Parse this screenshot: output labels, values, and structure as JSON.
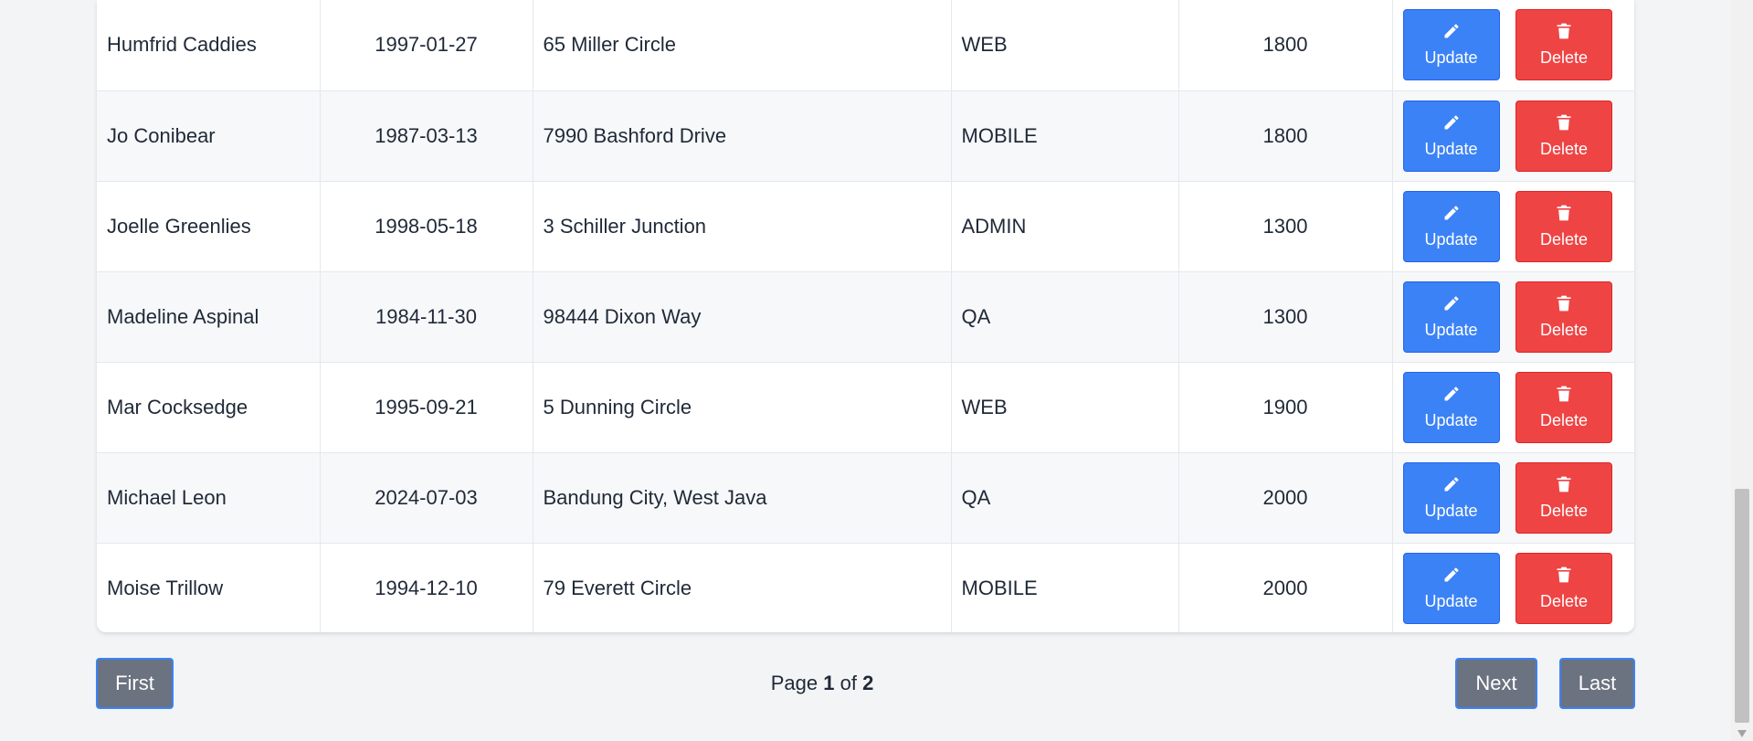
{
  "table": {
    "rows": [
      {
        "name": "Humfrid Caddies",
        "dob": "1997-01-27",
        "address": "65 Miller Circle",
        "role": "WEB",
        "salary": "1800"
      },
      {
        "name": "Jo Conibear",
        "dob": "1987-03-13",
        "address": "7990 Bashford Drive",
        "role": "MOBILE",
        "salary": "1800"
      },
      {
        "name": "Joelle Greenlies",
        "dob": "1998-05-18",
        "address": "3 Schiller Junction",
        "role": "ADMIN",
        "salary": "1300"
      },
      {
        "name": "Madeline Aspinal",
        "dob": "1984-11-30",
        "address": "98444 Dixon Way",
        "role": "QA",
        "salary": "1300"
      },
      {
        "name": "Mar Cocksedge",
        "dob": "1995-09-21",
        "address": "5 Dunning Circle",
        "role": "WEB",
        "salary": "1900"
      },
      {
        "name": "Michael Leon",
        "dob": "2024-07-03",
        "address": "Bandung City, West Java",
        "role": "QA",
        "salary": "2000"
      },
      {
        "name": "Moise Trillow",
        "dob": "1994-12-10",
        "address": "79 Everett Circle",
        "role": "MOBILE",
        "salary": "2000"
      }
    ],
    "update_label": "Update",
    "delete_label": "Delete",
    "update_icon": "pencil-icon",
    "delete_icon": "trash-icon"
  },
  "pagination": {
    "first_label": "First",
    "next_label": "Next",
    "last_label": "Last",
    "page_prefix": "Page",
    "current_page": "1",
    "page_sep": "of",
    "total_pages": "2"
  },
  "colors": {
    "update_button": "#3b82f6",
    "delete_button": "#ef4444",
    "pager_button": "#6b7280",
    "background": "#f3f4f6"
  }
}
